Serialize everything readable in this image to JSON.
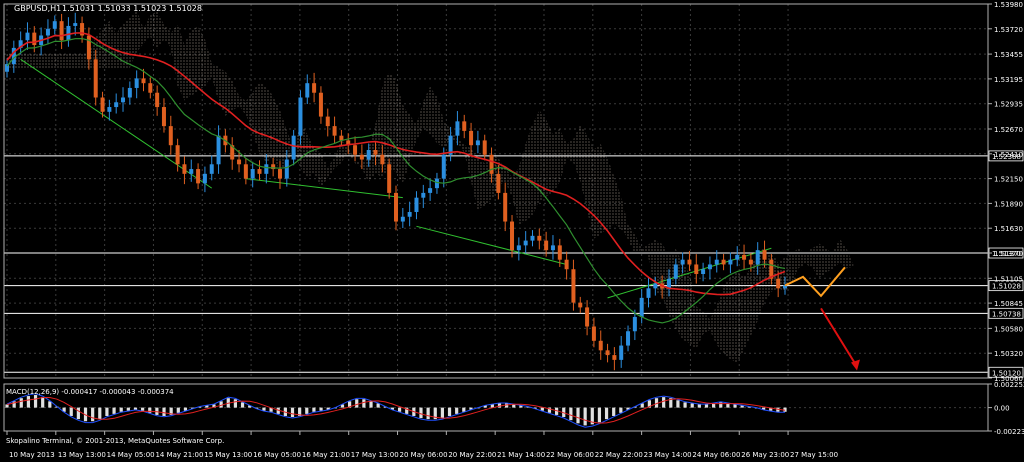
{
  "window": {
    "symbol_label": "GBPUSD,H1",
    "ohlc_label": "1.51031 1.51033 1.51023 1.51028",
    "copyright": "Skopalino Terminal, © 2001-2013, MetaQuotes Software Corp."
  },
  "colors": {
    "background": "#000000",
    "grid": "#3a3a3a",
    "bull_candle": "#2b8fe0",
    "bear_candle": "#e06020",
    "ma_fast": "#e02020",
    "ma_slow": "#2f8f2f",
    "trendline": "#30c030",
    "cloud": "#d8c8b8",
    "projection_up": "#ffa020",
    "projection_down": "#e01010",
    "price_line": "#ffffff",
    "macd_hist": "#e0e0e0",
    "macd_line": "#2050ff",
    "signal_line": "#e02020"
  },
  "chart_data": [
    {
      "type": "candlestick",
      "title": "GBPUSD,H1",
      "x_tick_labels": [
        "10 May 2013",
        "13 May 13:00",
        "14 May 05:00",
        "14 May 21:00",
        "15 May 13:00",
        "16 May 05:00",
        "16 May 21:00",
        "17 May 13:00",
        "20 May 06:00",
        "20 May 22:00",
        "21 May 14:00",
        "22 May 06:00",
        "22 May 22:00",
        "23 May 14:00",
        "24 May 06:00",
        "26 May 23:00",
        "27 May 15:00"
      ],
      "y_tick_labels": [
        "1.53980",
        "1.53720",
        "1.53455",
        "1.53195",
        "1.52935",
        "1.52670",
        "1.52410",
        "1.52150",
        "1.51890",
        "1.51630",
        "1.51370",
        "1.51105",
        "1.50845",
        "1.50580",
        "1.50320",
        "1.50060"
      ],
      "ylim": [
        1.5006,
        1.5398
      ],
      "horizontal_levels": [
        {
          "label": "1.52388",
          "value": 1.52388
        },
        {
          "label": "1.51370",
          "value": 1.5137
        },
        {
          "label": "1.51028",
          "value": 1.51028
        },
        {
          "label": "1.50738",
          "value": 1.50738
        },
        {
          "label": "1.50120",
          "value": 1.5012
        }
      ],
      "closes": [
        1.5335,
        1.5352,
        1.536,
        1.5368,
        1.5355,
        1.5365,
        1.5372,
        1.538,
        1.536,
        1.5375,
        1.5378,
        1.5365,
        1.534,
        1.53,
        1.5285,
        1.529,
        1.5295,
        1.53,
        1.531,
        1.532,
        1.5315,
        1.5305,
        1.529,
        1.527,
        1.525,
        1.523,
        1.522,
        1.5225,
        1.521,
        1.522,
        1.523,
        1.526,
        1.525,
        1.5235,
        1.523,
        1.5215,
        1.5225,
        1.522,
        1.523,
        1.5225,
        1.5215,
        1.5235,
        1.526,
        1.53,
        1.5315,
        1.5305,
        1.528,
        1.527,
        1.526,
        1.5255,
        1.525,
        1.524,
        1.5235,
        1.5245,
        1.524,
        1.523,
        1.52,
        1.517,
        1.5175,
        1.518,
        1.5195,
        1.52,
        1.5205,
        1.5215,
        1.524,
        1.526,
        1.5275,
        1.5265,
        1.525,
        1.5255,
        1.524,
        1.522,
        1.52,
        1.517,
        1.514,
        1.5145,
        1.515,
        1.5155,
        1.515,
        1.514,
        1.5145,
        1.513,
        1.512,
        1.5085,
        1.508,
        1.506,
        1.5045,
        1.5035,
        1.503,
        1.5025,
        1.504,
        1.5055,
        1.507,
        1.509,
        1.51,
        1.5105,
        1.51,
        1.511,
        1.5125,
        1.513,
        1.5125,
        1.5115,
        1.512,
        1.5125,
        1.513,
        1.5125,
        1.513,
        1.5135,
        1.513,
        1.5125,
        1.514,
        1.513,
        1.511,
        1.51,
        1.5103
      ],
      "projections": [
        {
          "color": "orange",
          "points": [
            [
              1.5103,
              0
            ],
            [
              1.5112,
              3
            ],
            [
              1.5092,
              6
            ],
            [
              1.5122,
              10
            ]
          ]
        },
        {
          "color": "red",
          "points": [
            [
              1.5079,
              0
            ],
            [
              1.5018,
              6
            ]
          ]
        }
      ]
    },
    {
      "type": "bar",
      "title": "MACD(12,26,9) -0.000417 -0.000043 -0.000374",
      "y_tick_labels": [
        "0.002252",
        "0.00",
        "-0.002232"
      ],
      "ylim": [
        -0.002232,
        0.002252
      ],
      "series": [
        {
          "name": "MACD",
          "values": [
            0.0003,
            0.0006,
            0.0009,
            0.0011,
            0.0012,
            0.001,
            0.0006,
            0.0001,
            -0.0004,
            -0.0008,
            -0.0011,
            -0.0013,
            -0.0013,
            -0.0011,
            -0.0008,
            -0.0006,
            -0.0004,
            -0.0003,
            -0.0002,
            -0.0003,
            -0.0005,
            -0.0007,
            -0.0008,
            -0.0007,
            -0.0005,
            -0.0003,
            -0.0001,
            0.0001,
            0.0002,
            0.0003,
            0.0006,
            0.0009,
            0.0008,
            0.0005,
            0.0002,
            -0.0001,
            -0.0003,
            -0.0004,
            -0.0006,
            -0.0008,
            -0.0009,
            -0.0008,
            -0.0006,
            -0.0004,
            -0.0003,
            -0.0002,
            0.0,
            0.0003,
            0.0006,
            0.0008,
            0.0008,
            0.0006,
            0.0004,
            0.0001,
            -0.0002,
            -0.0004,
            -0.0006,
            -0.0008,
            -0.001,
            -0.0011,
            -0.0011,
            -0.001,
            -0.0008,
            -0.0006,
            -0.0004,
            -0.0002,
            0.0,
            0.0002,
            0.0003,
            0.0004,
            0.0004,
            0.0003,
            0.0002,
            0.0001,
            -0.0001,
            -0.0003,
            -0.0005,
            -0.0007,
            -0.0009,
            -0.0012,
            -0.0015,
            -0.0017,
            -0.0016,
            -0.0014,
            -0.0011,
            -0.0008,
            -0.0005,
            -0.0002,
            0.0001,
            0.0004,
            0.0007,
            0.0009,
            0.001,
            0.0009,
            0.0007,
            0.0005,
            0.0004,
            0.0003,
            0.0003,
            0.0004,
            0.0005,
            0.0004,
            0.0003,
            0.0002,
            0.0001,
            0.0,
            -0.0002,
            -0.0003,
            -0.0004,
            -0.0004
          ]
        }
      ]
    }
  ]
}
